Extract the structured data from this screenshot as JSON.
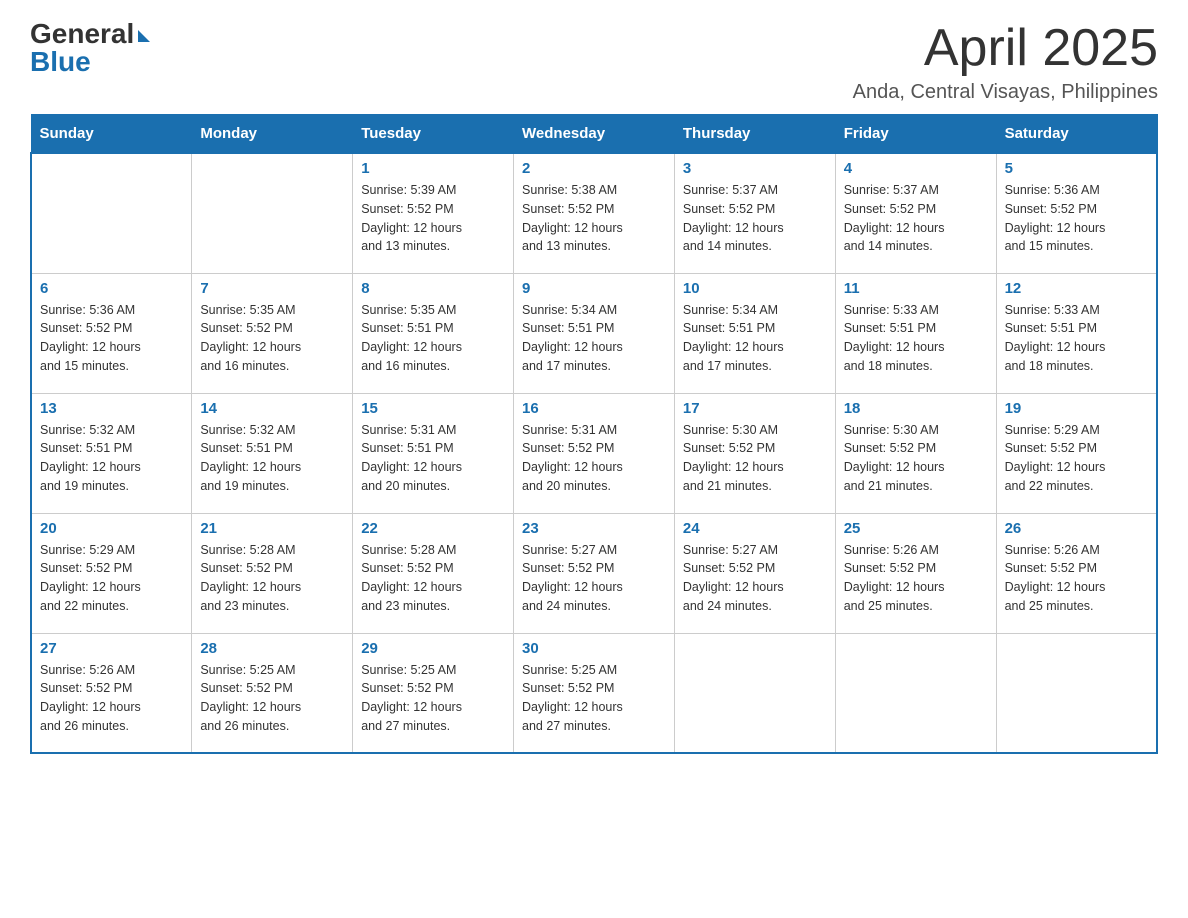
{
  "header": {
    "logo_general": "General",
    "logo_blue": "Blue",
    "title": "April 2025",
    "subtitle": "Anda, Central Visayas, Philippines"
  },
  "calendar": {
    "days_of_week": [
      "Sunday",
      "Monday",
      "Tuesday",
      "Wednesday",
      "Thursday",
      "Friday",
      "Saturday"
    ],
    "weeks": [
      [
        {
          "day": null,
          "info": null
        },
        {
          "day": null,
          "info": null
        },
        {
          "day": "1",
          "info": "Sunrise: 5:39 AM\nSunset: 5:52 PM\nDaylight: 12 hours\nand 13 minutes."
        },
        {
          "day": "2",
          "info": "Sunrise: 5:38 AM\nSunset: 5:52 PM\nDaylight: 12 hours\nand 13 minutes."
        },
        {
          "day": "3",
          "info": "Sunrise: 5:37 AM\nSunset: 5:52 PM\nDaylight: 12 hours\nand 14 minutes."
        },
        {
          "day": "4",
          "info": "Sunrise: 5:37 AM\nSunset: 5:52 PM\nDaylight: 12 hours\nand 14 minutes."
        },
        {
          "day": "5",
          "info": "Sunrise: 5:36 AM\nSunset: 5:52 PM\nDaylight: 12 hours\nand 15 minutes."
        }
      ],
      [
        {
          "day": "6",
          "info": "Sunrise: 5:36 AM\nSunset: 5:52 PM\nDaylight: 12 hours\nand 15 minutes."
        },
        {
          "day": "7",
          "info": "Sunrise: 5:35 AM\nSunset: 5:52 PM\nDaylight: 12 hours\nand 16 minutes."
        },
        {
          "day": "8",
          "info": "Sunrise: 5:35 AM\nSunset: 5:51 PM\nDaylight: 12 hours\nand 16 minutes."
        },
        {
          "day": "9",
          "info": "Sunrise: 5:34 AM\nSunset: 5:51 PM\nDaylight: 12 hours\nand 17 minutes."
        },
        {
          "day": "10",
          "info": "Sunrise: 5:34 AM\nSunset: 5:51 PM\nDaylight: 12 hours\nand 17 minutes."
        },
        {
          "day": "11",
          "info": "Sunrise: 5:33 AM\nSunset: 5:51 PM\nDaylight: 12 hours\nand 18 minutes."
        },
        {
          "day": "12",
          "info": "Sunrise: 5:33 AM\nSunset: 5:51 PM\nDaylight: 12 hours\nand 18 minutes."
        }
      ],
      [
        {
          "day": "13",
          "info": "Sunrise: 5:32 AM\nSunset: 5:51 PM\nDaylight: 12 hours\nand 19 minutes."
        },
        {
          "day": "14",
          "info": "Sunrise: 5:32 AM\nSunset: 5:51 PM\nDaylight: 12 hours\nand 19 minutes."
        },
        {
          "day": "15",
          "info": "Sunrise: 5:31 AM\nSunset: 5:51 PM\nDaylight: 12 hours\nand 20 minutes."
        },
        {
          "day": "16",
          "info": "Sunrise: 5:31 AM\nSunset: 5:52 PM\nDaylight: 12 hours\nand 20 minutes."
        },
        {
          "day": "17",
          "info": "Sunrise: 5:30 AM\nSunset: 5:52 PM\nDaylight: 12 hours\nand 21 minutes."
        },
        {
          "day": "18",
          "info": "Sunrise: 5:30 AM\nSunset: 5:52 PM\nDaylight: 12 hours\nand 21 minutes."
        },
        {
          "day": "19",
          "info": "Sunrise: 5:29 AM\nSunset: 5:52 PM\nDaylight: 12 hours\nand 22 minutes."
        }
      ],
      [
        {
          "day": "20",
          "info": "Sunrise: 5:29 AM\nSunset: 5:52 PM\nDaylight: 12 hours\nand 22 minutes."
        },
        {
          "day": "21",
          "info": "Sunrise: 5:28 AM\nSunset: 5:52 PM\nDaylight: 12 hours\nand 23 minutes."
        },
        {
          "day": "22",
          "info": "Sunrise: 5:28 AM\nSunset: 5:52 PM\nDaylight: 12 hours\nand 23 minutes."
        },
        {
          "day": "23",
          "info": "Sunrise: 5:27 AM\nSunset: 5:52 PM\nDaylight: 12 hours\nand 24 minutes."
        },
        {
          "day": "24",
          "info": "Sunrise: 5:27 AM\nSunset: 5:52 PM\nDaylight: 12 hours\nand 24 minutes."
        },
        {
          "day": "25",
          "info": "Sunrise: 5:26 AM\nSunset: 5:52 PM\nDaylight: 12 hours\nand 25 minutes."
        },
        {
          "day": "26",
          "info": "Sunrise: 5:26 AM\nSunset: 5:52 PM\nDaylight: 12 hours\nand 25 minutes."
        }
      ],
      [
        {
          "day": "27",
          "info": "Sunrise: 5:26 AM\nSunset: 5:52 PM\nDaylight: 12 hours\nand 26 minutes."
        },
        {
          "day": "28",
          "info": "Sunrise: 5:25 AM\nSunset: 5:52 PM\nDaylight: 12 hours\nand 26 minutes."
        },
        {
          "day": "29",
          "info": "Sunrise: 5:25 AM\nSunset: 5:52 PM\nDaylight: 12 hours\nand 27 minutes."
        },
        {
          "day": "30",
          "info": "Sunrise: 5:25 AM\nSunset: 5:52 PM\nDaylight: 12 hours\nand 27 minutes."
        },
        {
          "day": null,
          "info": null
        },
        {
          "day": null,
          "info": null
        },
        {
          "day": null,
          "info": null
        }
      ]
    ]
  }
}
